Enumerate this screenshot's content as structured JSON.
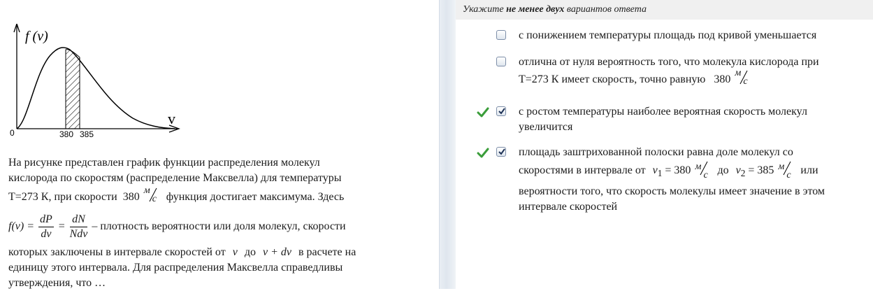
{
  "graph": {
    "y_label": "f (v)",
    "x_label": "v",
    "origin": "0",
    "tick_380": "380",
    "tick_385": "385"
  },
  "question": {
    "line1": "На рисунке представлен график функции распределения молекул",
    "line2": "кислорода по скоростям (распределение Максвелла) для температуры",
    "line3_a": "T=273 К, при  скорости",
    "line3_num": "380",
    "unit_m": "м",
    "unit_s": "с",
    "line3_b": "функция достигает максимума. Здесь",
    "formula_lhs": "f(v) =",
    "frac1_num": "dP",
    "frac1_den": "dv",
    "eq": "=",
    "frac2_num": "dN",
    "frac2_den": "Ndv",
    "line4_b": "–  плотность вероятности или доля молекул, скорости",
    "line5_a": "которых заключены в интервале скоростей от",
    "var_v": "v",
    "line5_do": "до",
    "var_vdv": "v + dv",
    "line5_b": "в расчете на",
    "line6": "единицу этого интервала. Для распределения Максвелла справедливы",
    "line7": "утверждения, что …"
  },
  "answers": {
    "header_pre": "Укажите ",
    "header_bold": "не менее двух",
    "header_post": " вариантов ответа",
    "options": [
      {
        "text": "с понижением температуры площадь под кривой уменьшается",
        "checked": false,
        "correct": false
      },
      {
        "line1": "отлична от нуля вероятность того, что молекула кислорода при",
        "line2": "T=273 К имеет скорость, точно равную",
        "num": "380",
        "checked": false,
        "correct": false
      },
      {
        "line1": "с ростом температуры наиболее вероятная скорость молекул",
        "line2": "увеличится",
        "checked": true,
        "correct": true
      },
      {
        "line1_a": "площадь заштрихованной полоски равна доле молекул со",
        "line2_a": "скоростями в интервале от",
        "v1": "v",
        "sub1": "1",
        "v1_val": "= 380",
        "do": "до",
        "v2": "v",
        "sub2": "2",
        "v2_val": "= 385",
        "line2_b": "или",
        "line3": "вероятности того, что скорость молекулы имеет значение в этом",
        "line4": "интервале скоростей",
        "checked": true,
        "correct": true
      }
    ]
  },
  "colors": {
    "check_green": "#3a9d3a",
    "checkbox_border": "#7d8ea8",
    "header_bg": "#f0f0f0"
  }
}
